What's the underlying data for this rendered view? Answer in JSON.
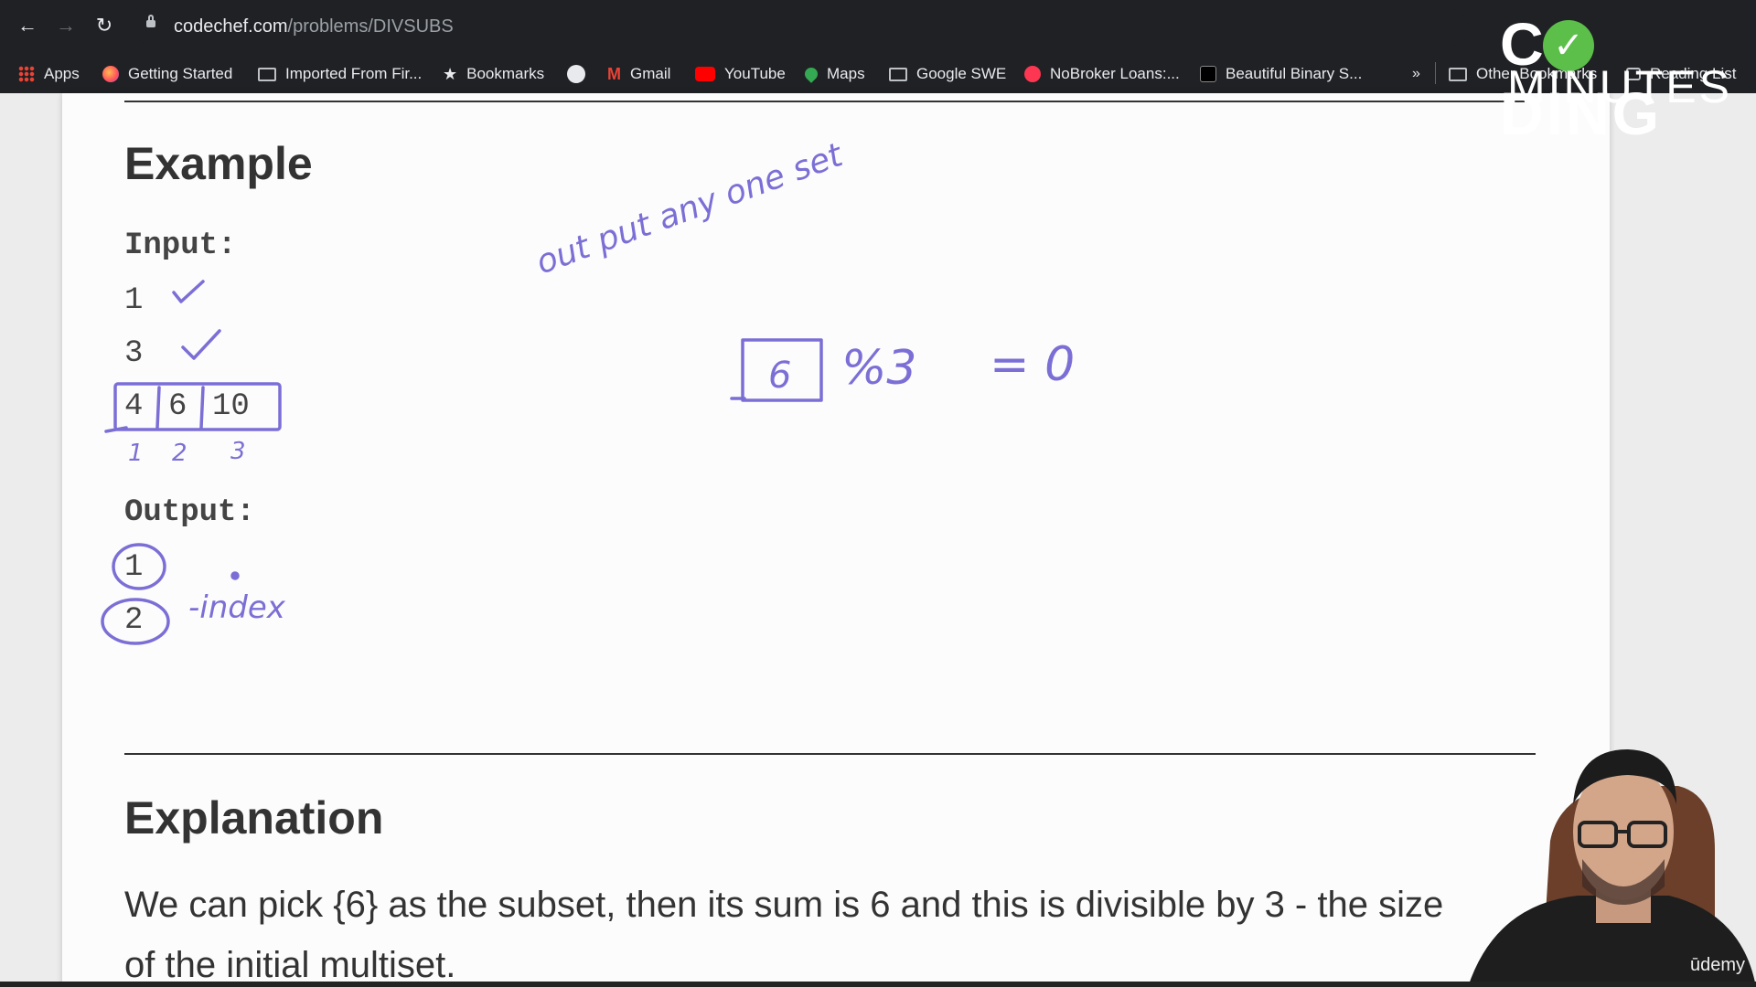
{
  "browser": {
    "url_domain": "codechef.com",
    "url_path": "/problems/DIVSUBS",
    "bookmarks": [
      {
        "label": "Apps",
        "icon": "apps-grid-icon"
      },
      {
        "label": "Getting Started",
        "icon": "firefox-icon"
      },
      {
        "label": "Imported From Fir...",
        "icon": "folder-icon"
      },
      {
        "label": "Bookmarks",
        "icon": "star-icon"
      },
      {
        "label": "",
        "icon": "github-icon"
      },
      {
        "label": "Gmail",
        "icon": "gmail-icon"
      },
      {
        "label": "YouTube",
        "icon": "youtube-icon"
      },
      {
        "label": "Maps",
        "icon": "maps-icon"
      },
      {
        "label": "Google SWE",
        "icon": "folder-icon"
      },
      {
        "label": "NoBroker Loans:...",
        "icon": "nobroker-icon"
      },
      {
        "label": "Beautiful Binary S...",
        "icon": "hackerrank-icon"
      }
    ],
    "overflow": "»",
    "other_bookmarks": "Other Bookmarks",
    "reading_list": "Reading List"
  },
  "overlay_logo": {
    "line1_a": "C",
    "line1_b": "DING",
    "line2": "MINUTES"
  },
  "problem": {
    "example_heading": "Example",
    "input_label": "Input:",
    "input_lines": [
      "1",
      "3"
    ],
    "array": [
      "4",
      "6",
      "10"
    ],
    "output_label": "Output:",
    "output_lines": [
      "1",
      "2"
    ],
    "explanation_heading": "Explanation",
    "explanation_text_1": "We can pick {6} as the subset, then its sum is 6 and this is divisible by 3 - the size",
    "explanation_text_2": "of the initial multiset."
  },
  "annotations": {
    "note_1": "out put  any one  set",
    "calc_box": "6",
    "calc_rest": "%3",
    "calc_eq": "= 0",
    "indices": [
      "1",
      "2",
      "3"
    ],
    "index_label": "-index"
  },
  "watermark": "ūdemy",
  "colors": {
    "ink": "#7b6fd6",
    "chrome": "#202124",
    "page": "#fcfcfc"
  }
}
